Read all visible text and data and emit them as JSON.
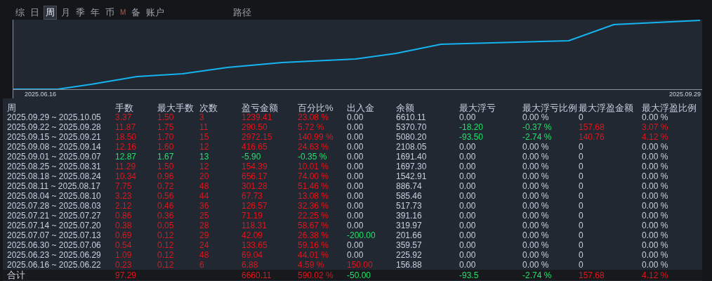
{
  "tabs": [
    {
      "label": "综",
      "selected": false,
      "disabled": false
    },
    {
      "label": "日",
      "selected": false,
      "disabled": false
    },
    {
      "label": "周",
      "selected": true,
      "disabled": false
    },
    {
      "label": "月",
      "selected": false,
      "disabled": false
    },
    {
      "label": "季",
      "selected": false,
      "disabled": false
    },
    {
      "label": "年",
      "selected": false,
      "disabled": false
    },
    {
      "label": "币",
      "selected": false,
      "disabled": false
    },
    {
      "label": "M",
      "selected": false,
      "disabled": true
    },
    {
      "label": "备",
      "selected": false,
      "disabled": false
    },
    {
      "label": "账户",
      "selected": false,
      "disabled": false
    },
    {
      "label": "路径",
      "selected": false,
      "disabled": false
    }
  ],
  "chart": {
    "start_label": "2025.06.16",
    "end_label": "2025.09.29"
  },
  "table": {
    "columns": [
      "周",
      "手数",
      "最大手数",
      "次数",
      "盈亏金额",
      "百分比%",
      "出入金",
      "余额",
      "最大浮亏",
      "最大浮亏比例",
      "最大浮盈金额",
      "最大浮盈比例"
    ],
    "rows": [
      {
        "cells": [
          {
            "text": "2025.09.29 ~ 2025.10.05"
          },
          {
            "text": "3.37",
            "color": "#e3141b"
          },
          {
            "text": "1.50",
            "color": "#e3141b"
          },
          {
            "text": "3",
            "color": "#e3141b"
          },
          {
            "text": "1239.41",
            "color": "#e3141b"
          },
          {
            "text": "23.08 %",
            "color": "#e3141b"
          },
          {
            "text": "0.00"
          },
          {
            "text": "6610.11"
          },
          {
            "text": "0.00"
          },
          {
            "text": "0.00 %"
          },
          {
            "text": "0"
          },
          {
            "text": "0.00 %"
          }
        ]
      },
      {
        "cells": [
          {
            "text": "2025.09.22 ~ 2025.09.28"
          },
          {
            "text": "11.87",
            "color": "#e3141b"
          },
          {
            "text": "1.75",
            "color": "#e3141b"
          },
          {
            "text": "11",
            "color": "#e3141b"
          },
          {
            "text": "290.50",
            "color": "#e3141b"
          },
          {
            "text": "5.72 %",
            "color": "#e3141b"
          },
          {
            "text": "0.00"
          },
          {
            "text": "5370.70"
          },
          {
            "text": "-18.20",
            "color": "#1fe36c"
          },
          {
            "text": "-0.37 %",
            "color": "#1fe36c"
          },
          {
            "text": "157.68",
            "color": "#e3141b"
          },
          {
            "text": "3.07 %",
            "color": "#e3141b"
          }
        ]
      },
      {
        "cells": [
          {
            "text": "2025.09.15 ~ 2025.09.21"
          },
          {
            "text": "18.50",
            "color": "#e3141b"
          },
          {
            "text": "1.70",
            "color": "#e3141b"
          },
          {
            "text": "15",
            "color": "#e3141b"
          },
          {
            "text": "2972.15",
            "color": "#e3141b"
          },
          {
            "text": "140.99 %",
            "color": "#e3141b"
          },
          {
            "text": "0.00"
          },
          {
            "text": "5080.20"
          },
          {
            "text": "-93.50",
            "color": "#1fe36c"
          },
          {
            "text": "-2.74 %",
            "color": "#1fe36c"
          },
          {
            "text": "140.76",
            "color": "#e3141b"
          },
          {
            "text": "4.12 %",
            "color": "#e3141b"
          }
        ]
      },
      {
        "cells": [
          {
            "text": "2025.09.08 ~ 2025.09.14"
          },
          {
            "text": "12.16",
            "color": "#e3141b"
          },
          {
            "text": "1.60",
            "color": "#e3141b"
          },
          {
            "text": "12",
            "color": "#e3141b"
          },
          {
            "text": "416.65",
            "color": "#e3141b"
          },
          {
            "text": "24.63 %",
            "color": "#e3141b"
          },
          {
            "text": "0.00"
          },
          {
            "text": "2108.05"
          },
          {
            "text": "0.00"
          },
          {
            "text": "0.00 %"
          },
          {
            "text": "0"
          },
          {
            "text": "0.00 %"
          }
        ]
      },
      {
        "cells": [
          {
            "text": "2025.09.01 ~ 2025.09.07"
          },
          {
            "text": "12.87",
            "color": "#1fe36c"
          },
          {
            "text": "1.67",
            "color": "#1fe36c"
          },
          {
            "text": "13",
            "color": "#1fe36c"
          },
          {
            "text": "-5.90",
            "color": "#1fe36c"
          },
          {
            "text": "-0.35 %",
            "color": "#1fe36c"
          },
          {
            "text": "0.00"
          },
          {
            "text": "1691.40"
          },
          {
            "text": "0.00"
          },
          {
            "text": "0.00 %"
          },
          {
            "text": "0"
          },
          {
            "text": "0.00 %"
          }
        ]
      },
      {
        "cells": [
          {
            "text": "2025.08.25 ~ 2025.08.31"
          },
          {
            "text": "11.29",
            "color": "#e3141b"
          },
          {
            "text": "1.50",
            "color": "#e3141b"
          },
          {
            "text": "12",
            "color": "#e3141b"
          },
          {
            "text": "154.39",
            "color": "#e3141b"
          },
          {
            "text": "10.01 %",
            "color": "#e3141b"
          },
          {
            "text": "0.00"
          },
          {
            "text": "1697.30"
          },
          {
            "text": "0.00"
          },
          {
            "text": "0.00 %"
          },
          {
            "text": "0"
          },
          {
            "text": "0.00 %"
          }
        ]
      },
      {
        "cells": [
          {
            "text": "2025.08.18 ~ 2025.08.24"
          },
          {
            "text": "10.34",
            "color": "#e3141b"
          },
          {
            "text": "0.96",
            "color": "#e3141b"
          },
          {
            "text": "20",
            "color": "#e3141b"
          },
          {
            "text": "656.17",
            "color": "#e3141b"
          },
          {
            "text": "74.00 %",
            "color": "#e3141b"
          },
          {
            "text": "0.00"
          },
          {
            "text": "1542.91"
          },
          {
            "text": "0.00"
          },
          {
            "text": "0.00 %"
          },
          {
            "text": "0"
          },
          {
            "text": "0.00 %"
          }
        ]
      },
      {
        "cells": [
          {
            "text": "2025.08.11 ~ 2025.08.17"
          },
          {
            "text": "7.75",
            "color": "#e3141b"
          },
          {
            "text": "0.72",
            "color": "#e3141b"
          },
          {
            "text": "48",
            "color": "#e3141b"
          },
          {
            "text": "301.28",
            "color": "#e3141b"
          },
          {
            "text": "51.46 %",
            "color": "#e3141b"
          },
          {
            "text": "0.00"
          },
          {
            "text": "886.74"
          },
          {
            "text": "0.00"
          },
          {
            "text": "0.00 %"
          },
          {
            "text": "0"
          },
          {
            "text": "0.00 %"
          }
        ]
      },
      {
        "cells": [
          {
            "text": "2025.08.04 ~ 2025.08.10"
          },
          {
            "text": "3.23",
            "color": "#e3141b"
          },
          {
            "text": "0.56",
            "color": "#e3141b"
          },
          {
            "text": "44",
            "color": "#e3141b"
          },
          {
            "text": "67.73",
            "color": "#e3141b"
          },
          {
            "text": "13.08 %",
            "color": "#e3141b"
          },
          {
            "text": "0.00"
          },
          {
            "text": "585.46"
          },
          {
            "text": "0.00"
          },
          {
            "text": "0.00 %"
          },
          {
            "text": "0"
          },
          {
            "text": "0.00 %"
          }
        ]
      },
      {
        "cells": [
          {
            "text": "2025.07.28 ~ 2025.08.03"
          },
          {
            "text": "2.12",
            "color": "#e3141b"
          },
          {
            "text": "0.46",
            "color": "#e3141b"
          },
          {
            "text": "36",
            "color": "#e3141b"
          },
          {
            "text": "126.57",
            "color": "#e3141b"
          },
          {
            "text": "32.36 %",
            "color": "#e3141b"
          },
          {
            "text": "0.00"
          },
          {
            "text": "517.73"
          },
          {
            "text": "0.00"
          },
          {
            "text": "0.00 %"
          },
          {
            "text": "0"
          },
          {
            "text": "0.00 %"
          }
        ]
      },
      {
        "cells": [
          {
            "text": "2025.07.21 ~ 2025.07.27"
          },
          {
            "text": "0.86",
            "color": "#e3141b"
          },
          {
            "text": "0.36",
            "color": "#e3141b"
          },
          {
            "text": "25",
            "color": "#e3141b"
          },
          {
            "text": "71.19",
            "color": "#e3141b"
          },
          {
            "text": "22.25 %",
            "color": "#e3141b"
          },
          {
            "text": "0.00"
          },
          {
            "text": "391.16"
          },
          {
            "text": "0.00"
          },
          {
            "text": "0.00 %"
          },
          {
            "text": "0"
          },
          {
            "text": "0.00 %"
          }
        ]
      },
      {
        "cells": [
          {
            "text": "2025.07.14 ~ 2025.07.20"
          },
          {
            "text": "0.38",
            "color": "#e3141b"
          },
          {
            "text": "0.05",
            "color": "#e3141b"
          },
          {
            "text": "28",
            "color": "#e3141b"
          },
          {
            "text": "118.31",
            "color": "#e3141b"
          },
          {
            "text": "58.67 %",
            "color": "#e3141b"
          },
          {
            "text": "0.00"
          },
          {
            "text": "319.97"
          },
          {
            "text": "0.00"
          },
          {
            "text": "0.00 %"
          },
          {
            "text": "0"
          },
          {
            "text": "0.00 %"
          }
        ]
      },
      {
        "cells": [
          {
            "text": "2025.07.07 ~ 2025.07.13"
          },
          {
            "text": "0.69",
            "color": "#e3141b"
          },
          {
            "text": "0.12",
            "color": "#e3141b"
          },
          {
            "text": "29",
            "color": "#e3141b"
          },
          {
            "text": "42.09",
            "color": "#e3141b"
          },
          {
            "text": "26.38 %",
            "color": "#e3141b"
          },
          {
            "text": "-200.00",
            "color": "#1fe36c"
          },
          {
            "text": "201.66"
          },
          {
            "text": "0.00"
          },
          {
            "text": "0.00 %"
          },
          {
            "text": "0"
          },
          {
            "text": "0.00 %"
          }
        ]
      },
      {
        "cells": [
          {
            "text": "2025.06.30 ~ 2025.07.06"
          },
          {
            "text": "0.54",
            "color": "#e3141b"
          },
          {
            "text": "0.12",
            "color": "#e3141b"
          },
          {
            "text": "24",
            "color": "#e3141b"
          },
          {
            "text": "133.65",
            "color": "#e3141b"
          },
          {
            "text": "59.16 %",
            "color": "#e3141b"
          },
          {
            "text": "0.00"
          },
          {
            "text": "359.57"
          },
          {
            "text": "0.00"
          },
          {
            "text": "0.00 %"
          },
          {
            "text": "0"
          },
          {
            "text": "0.00 %"
          }
        ]
      },
      {
        "cells": [
          {
            "text": "2025.06.23 ~ 2025.06.29"
          },
          {
            "text": "1.09",
            "color": "#e3141b"
          },
          {
            "text": "0.12",
            "color": "#e3141b"
          },
          {
            "text": "48",
            "color": "#e3141b"
          },
          {
            "text": "69.04",
            "color": "#e3141b"
          },
          {
            "text": "44.01 %",
            "color": "#e3141b"
          },
          {
            "text": "0.00"
          },
          {
            "text": "225.92"
          },
          {
            "text": "0.00"
          },
          {
            "text": "0.00 %"
          },
          {
            "text": "0"
          },
          {
            "text": "0.00 %"
          }
        ]
      },
      {
        "cells": [
          {
            "text": "2025.06.16 ~ 2025.06.22"
          },
          {
            "text": "0.23",
            "color": "#e3141b"
          },
          {
            "text": "0.12",
            "color": "#e3141b"
          },
          {
            "text": "6",
            "color": "#e3141b"
          },
          {
            "text": "6.88",
            "color": "#e3141b"
          },
          {
            "text": "4.59 %",
            "color": "#e3141b"
          },
          {
            "text": "150.00",
            "color": "#e3141b"
          },
          {
            "text": "156.88"
          },
          {
            "text": "0.00"
          },
          {
            "text": "0.00 %"
          },
          {
            "text": "0"
          },
          {
            "text": "0.00 %"
          }
        ]
      }
    ],
    "total": {
      "label": {
        "text": "合计"
      },
      "lots": {
        "text": "97.29",
        "color": "#e3141b"
      },
      "profit": {
        "text": "6660.11",
        "color": "#e3141b"
      },
      "percent": {
        "text": "590.02 %",
        "color": "#e3141b"
      },
      "deposit": {
        "text": "-50.00",
        "color": "#1fe36c"
      },
      "max_drawdown": {
        "text": "-93.5",
        "color": "#1fe36c"
      },
      "max_drawdown_ratio": {
        "text": "-2.74 %",
        "color": "#1fe36c"
      },
      "max_float_profit": {
        "text": "157.68",
        "color": "#e3141b"
      },
      "max_float_profit_ratio": {
        "text": "4.12 %",
        "color": "#e3141b"
      }
    }
  }
}
